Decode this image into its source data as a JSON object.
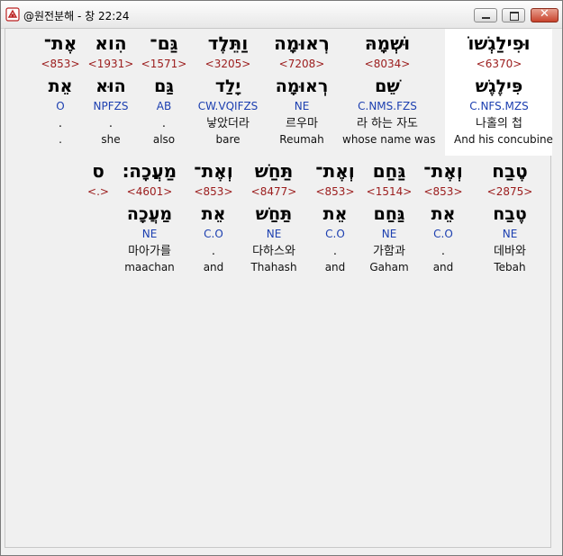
{
  "window": {
    "title": "@원전분해 - 창 22:24",
    "buttons": {
      "minimize": "minimize",
      "maximize": "maximize",
      "close": "✕"
    }
  },
  "row1": [
    {
      "heb": "וּפִילַגְשׁוֹ",
      "strong": "<6370>",
      "lemma": "פִּילֶגֶשׁ",
      "morph": "C.NFS.MZS",
      "kor": "나홀의 첩",
      "eng": "And his concubine"
    },
    {
      "heb": "וּשְׁמָהּ",
      "strong": "<8034>",
      "lemma": "שֵׁם",
      "morph": "C.NMS.FZS",
      "kor": "라 하는 자도",
      "eng": "whose name was"
    },
    {
      "heb": "רְאוּמָה",
      "strong": "<7208>",
      "lemma": "רְאוּמָה",
      "morph": "NE",
      "kor": "르우마",
      "eng": "Reumah"
    },
    {
      "heb": "וַתֵּלֶד",
      "strong": "<3205>",
      "lemma": "יָלַד",
      "morph": "CW.VQIFZS",
      "kor": "낳았더라",
      "eng": "bare"
    },
    {
      "heb": "גַּם־",
      "strong": "<1571>",
      "lemma": "גַּם",
      "morph": "AB",
      "kor": ".",
      "eng": "also"
    },
    {
      "heb": "הִוא",
      "strong": "<1931>",
      "lemma": "הוּא",
      "morph": "NPFZS",
      "kor": ".",
      "eng": "she"
    },
    {
      "heb": "אֶת־",
      "strong": "<853>",
      "lemma": "אֵת",
      "morph": "O",
      "kor": ".",
      "eng": "."
    }
  ],
  "row2": [
    {
      "heb": "טֶבַח",
      "strong": "<2875>",
      "lemma": "טֶבַח",
      "morph": "NE",
      "kor": "데바와",
      "eng": "Tebah"
    },
    {
      "heb": "וְאֶת־",
      "strong": "<853>",
      "lemma": "אֵת",
      "morph": "C.O",
      "kor": ".",
      "eng": "and"
    },
    {
      "heb": "גַּחַם",
      "strong": "<1514>",
      "lemma": "גַּחַם",
      "morph": "NE",
      "kor": "가함과",
      "eng": "Gaham"
    },
    {
      "heb": "וְאֶת־",
      "strong": "<853>",
      "lemma": "אֵת",
      "morph": "C.O",
      "kor": ".",
      "eng": "and"
    },
    {
      "heb": "תַּחַשׁ",
      "strong": "<8477>",
      "lemma": "תַּחַשׁ",
      "morph": "NE",
      "kor": "다하스와",
      "eng": "Thahash"
    },
    {
      "heb": "וְאֶת־",
      "strong": "<853>",
      "lemma": "אֵת",
      "morph": "C.O",
      "kor": ".",
      "eng": "and"
    },
    {
      "heb": "מַעֲכָה׃",
      "strong": "<4601>",
      "lemma": "מַעֲכָה",
      "morph": "NE",
      "kor": "마아가를",
      "eng": "maachan"
    },
    {
      "heb": "ס",
      "strong": "<.>",
      "lemma": "",
      "morph": "",
      "kor": "",
      "eng": ""
    }
  ]
}
